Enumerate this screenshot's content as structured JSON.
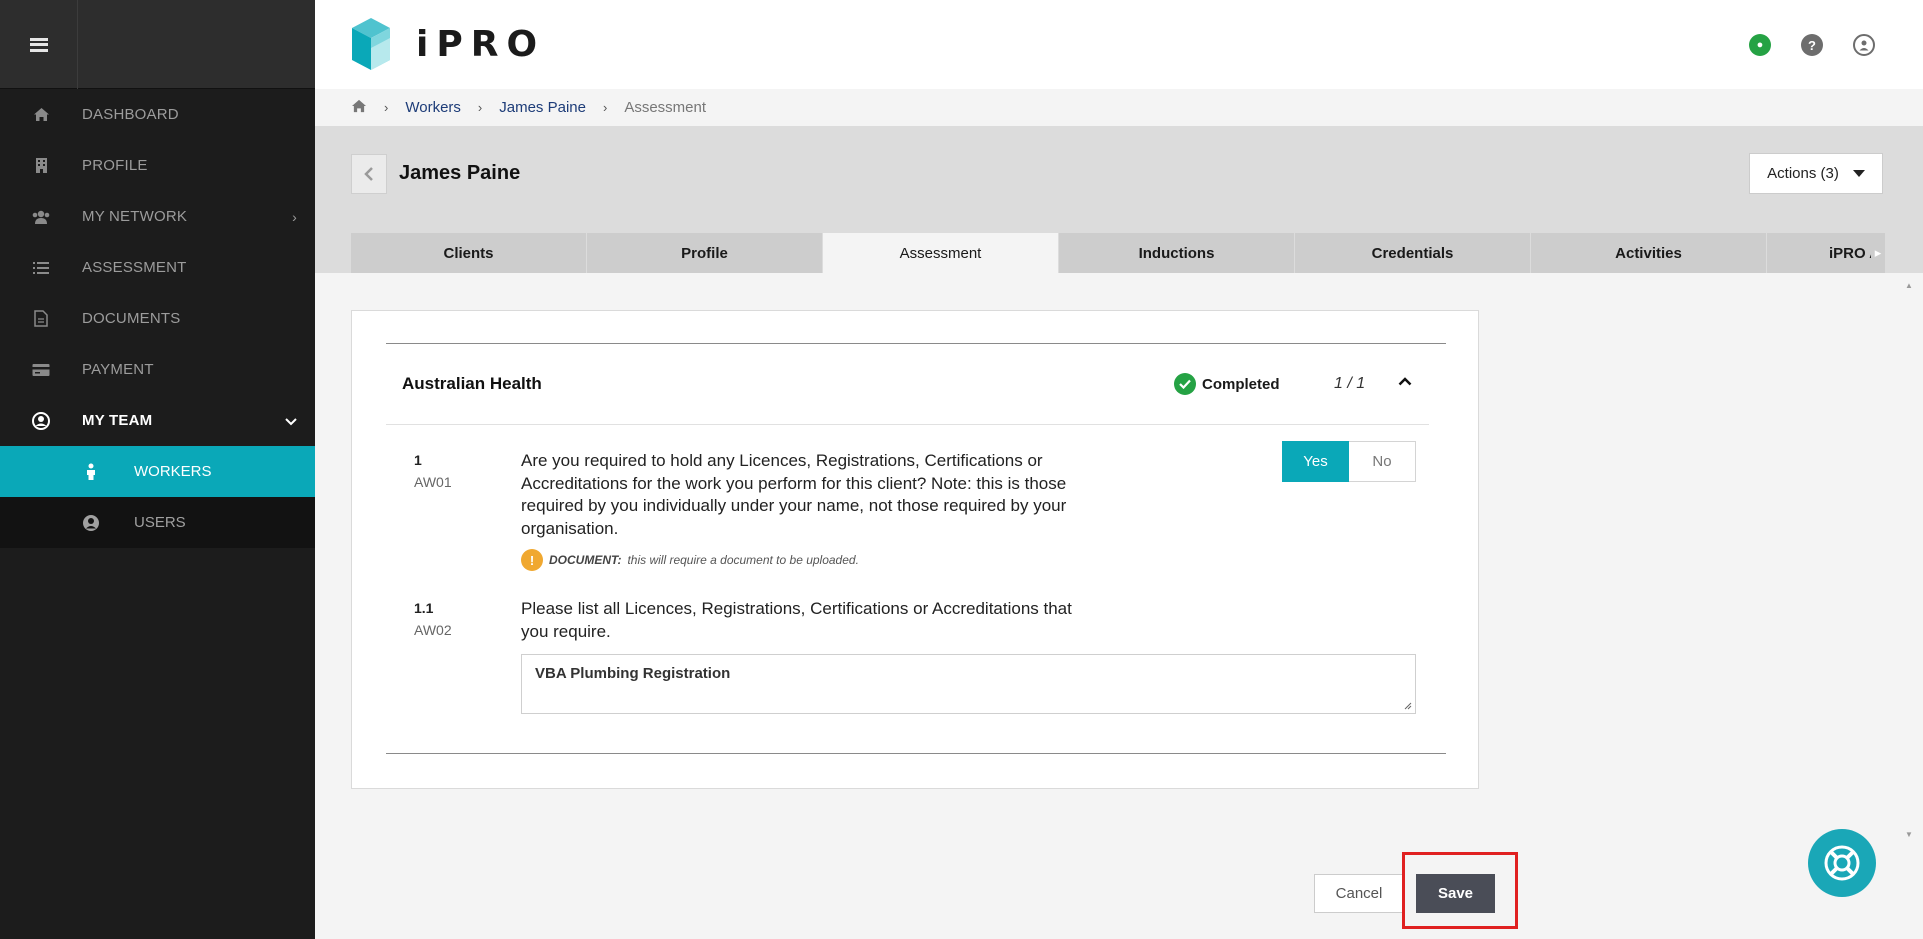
{
  "app": {
    "logo_text": "iPRO",
    "brand_color": "#0aa8b8"
  },
  "sidebar": {
    "items": [
      {
        "label": "DASHBOARD",
        "icon": "home-icon"
      },
      {
        "label": "PROFILE",
        "icon": "building-icon"
      },
      {
        "label": "MY NETWORK",
        "icon": "users-icon"
      },
      {
        "label": "ASSESSMENT",
        "icon": "list-icon"
      },
      {
        "label": "DOCUMENTS",
        "icon": "document-icon"
      },
      {
        "label": "PAYMENT",
        "icon": "credit-card-icon"
      },
      {
        "label": "MY TEAM",
        "icon": "user-circle-icon"
      }
    ],
    "subitems": [
      {
        "label": "WORKERS",
        "icon": "person-icon"
      },
      {
        "label": "USERS",
        "icon": "user-circle-icon"
      }
    ]
  },
  "breadcrumb": {
    "items": [
      "Workers",
      "James Paine"
    ],
    "current": "Assessment"
  },
  "header": {
    "worker_name": "James Paine",
    "actions_label": "Actions (3)"
  },
  "tabs": [
    "Clients",
    "Profile",
    "Assessment",
    "Inductions",
    "Credentials",
    "Activities",
    "iPRO Ac"
  ],
  "section": {
    "title": "Australian Health",
    "status": "Completed",
    "count": "1 / 1"
  },
  "questions": [
    {
      "number": "1",
      "code": "AW01",
      "text": "Are you required to hold any Licences, Registrations, Certifications or Accreditations for the work you perform for this client? Note: this is those required by you individually under your name, not those required by your organisation.",
      "note_label": "DOCUMENT:",
      "note_text": "this will require a document to be uploaded.",
      "yes_label": "Yes",
      "no_label": "No",
      "selected": "Yes"
    },
    {
      "number": "1.1",
      "code": "AW02",
      "text": "Please list all Licences, Registrations, Certifications or Accreditations that you require.",
      "answer": "VBA Plumbing Registration"
    }
  ],
  "footer": {
    "cancel_label": "Cancel",
    "save_label": "Save"
  }
}
